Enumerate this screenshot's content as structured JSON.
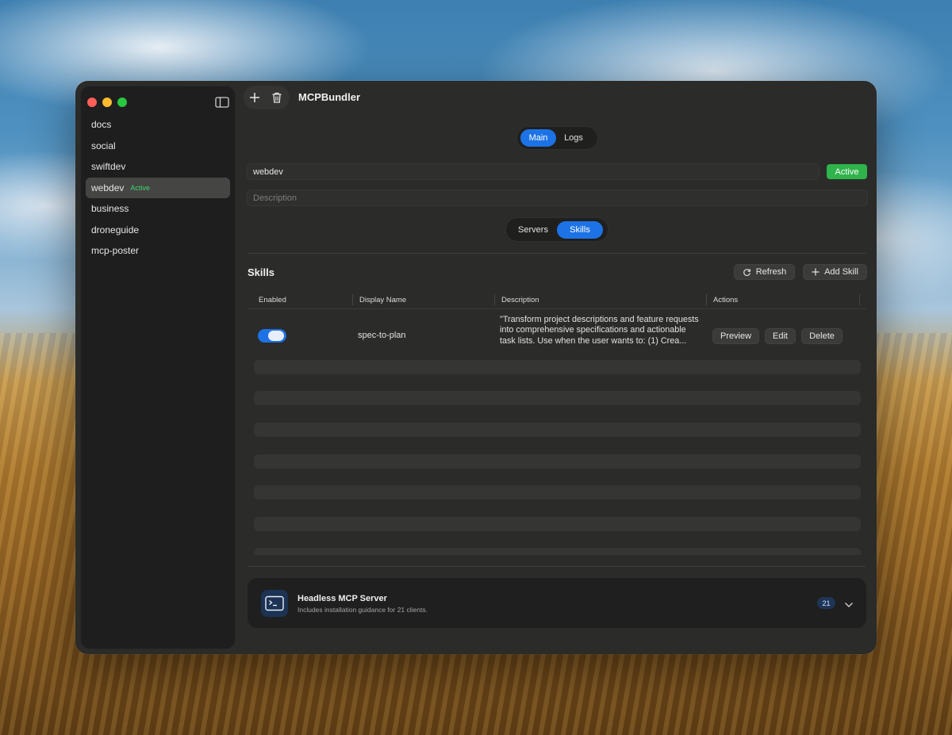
{
  "app": {
    "title": "MCPBundler"
  },
  "sidebar": {
    "items": [
      {
        "label": "docs",
        "badge": ""
      },
      {
        "label": "social",
        "badge": ""
      },
      {
        "label": "swiftdev",
        "badge": ""
      },
      {
        "label": "webdev",
        "badge": "Active",
        "selected": true
      },
      {
        "label": "business",
        "badge": ""
      },
      {
        "label": "droneguide",
        "badge": ""
      },
      {
        "label": "mcp-poster",
        "badge": ""
      }
    ]
  },
  "view_tabs": {
    "main": "Main",
    "logs": "Logs",
    "selected": "Main"
  },
  "project": {
    "name_value": "webdev",
    "status": "Active",
    "description_placeholder": "Description"
  },
  "section_tabs": {
    "servers": "Servers",
    "skills": "Skills",
    "selected": "Skills"
  },
  "skills": {
    "title": "Skills",
    "refresh_label": "Refresh",
    "add_label": "Add Skill",
    "columns": [
      "Enabled",
      "Display Name",
      "Description",
      "Actions"
    ],
    "rows": [
      {
        "enabled": true,
        "display_name": "spec-to-plan",
        "description": "\"Transform project descriptions and feature requests into comprehensive specifications and actionable task lists. Use when the user wants to: (1) Crea...",
        "actions": [
          "Preview",
          "Edit",
          "Delete"
        ]
      }
    ]
  },
  "headless": {
    "title": "Headless MCP Server",
    "subtitle": "Includes installation guidance for 21 clients.",
    "count": "21"
  },
  "colors": {
    "accent": "#1d73e6",
    "active_green": "#2fb34b",
    "window_bg": "#2b2b29",
    "sidebar_bg": "#1e1e1e"
  },
  "icons": {
    "sidebar_toggle": "sidebar-toggle-icon",
    "add": "plus-icon",
    "delete": "trash-icon",
    "refresh": "refresh-icon",
    "add_skill": "plus-icon",
    "terminal": "terminal-icon",
    "expand": "chevron-down-icon"
  }
}
